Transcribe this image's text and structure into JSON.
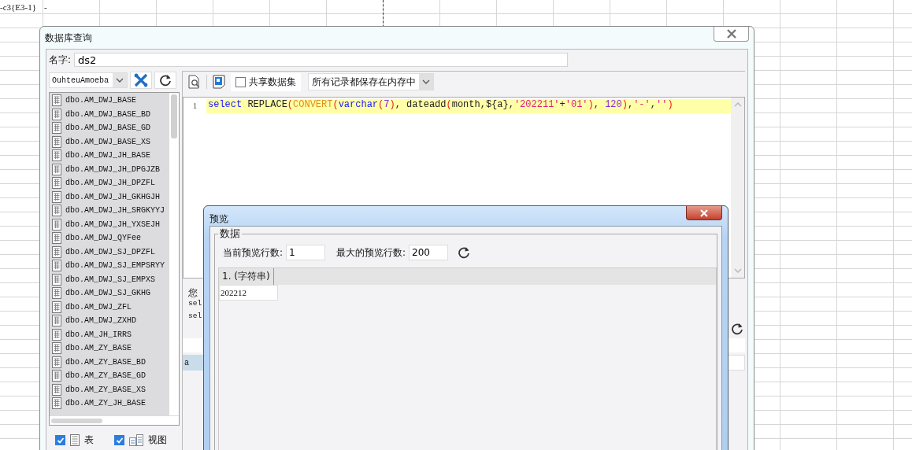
{
  "spreadsheet": {
    "cells": [
      "-c3{E3-1}",
      "-"
    ]
  },
  "dialog": {
    "title": "数据库查询",
    "name_label": "名字:",
    "name_value": "ds2",
    "connection": "OuhteuAmoeba",
    "tables": [
      "dbo.AM_DWJ_BASE",
      "dbo.AM_DWJ_BASE_BD",
      "dbo.AM_DWJ_BASE_GD",
      "dbo.AM_DWJ_BASE_XS",
      "dbo.AM_DWJ_JH_BASE",
      "dbo.AM_DWJ_JH_DPGJZB",
      "dbo.AM_DWJ_JH_DPZFL",
      "dbo.AM_DWJ_JH_GKHGJH",
      "dbo.AM_DWJ_JH_SRGKYYJ",
      "dbo.AM_DWJ_JH_YXSEJH",
      "dbo.AM_DWJ_QYFee",
      "dbo.AM_DWJ_SJ_DPZFL",
      "dbo.AM_DWJ_SJ_EMPSRYY",
      "dbo.AM_DWJ_SJ_EMPXS",
      "dbo.AM_DWJ_SJ_GKHG",
      "dbo.AM_DWJ_ZFL",
      "dbo.AM_DWJ_ZXHD",
      "dbo.AM_JH_IRRS",
      "dbo.AM_ZY_BASE",
      "dbo.AM_ZY_BASE_BD",
      "dbo.AM_ZY_BASE_GD",
      "dbo.AM_ZY_BASE_XS",
      "dbo.AM_ZY_JH_BASE"
    ],
    "filters": [
      {
        "label": "表",
        "kind": "table",
        "checked": true
      },
      {
        "label": "视图",
        "kind": "view",
        "checked": true
      }
    ],
    "share_checkbox": {
      "label": "共享数据集",
      "checked": false
    },
    "storage_mode": "所有记录都保存在内存中",
    "editor": {
      "line_number": "1",
      "tokens": [
        {
          "text": "select",
          "kind": "keyword"
        },
        {
          "text": " REPLACE",
          "kind": "plain"
        },
        {
          "text": "(",
          "kind": "paren"
        },
        {
          "text": "CONVERT",
          "kind": "function"
        },
        {
          "text": "(",
          "kind": "paren"
        },
        {
          "text": "varchar",
          "kind": "keyword"
        },
        {
          "text": "(",
          "kind": "paren"
        },
        {
          "text": "7",
          "kind": "number"
        },
        {
          "text": ")",
          "kind": "paren"
        },
        {
          "text": ", dateadd",
          "kind": "plain"
        },
        {
          "text": "(",
          "kind": "paren"
        },
        {
          "text": "month,${a},",
          "kind": "plain"
        },
        {
          "text": "'202211'",
          "kind": "string"
        },
        {
          "text": "+",
          "kind": "plain"
        },
        {
          "text": "'01'",
          "kind": "string"
        },
        {
          "text": ")",
          "kind": "paren"
        },
        {
          "text": ", ",
          "kind": "plain"
        },
        {
          "text": "120",
          "kind": "number"
        },
        {
          "text": ")",
          "kind": "paren"
        },
        {
          "text": ",",
          "kind": "plain"
        },
        {
          "text": "'-'",
          "kind": "string"
        },
        {
          "text": ",",
          "kind": "plain"
        },
        {
          "text": "''",
          "kind": "string"
        },
        {
          "text": ")",
          "kind": "paren"
        }
      ]
    },
    "hint_lines": [
      {
        "text": "您",
        "kind": "prose"
      },
      {
        "text": "sel",
        "kind": "code"
      },
      {
        "text": "sel",
        "kind": "code"
      }
    ],
    "params_table": {
      "rows": [
        {
          "name": "a",
          "selected": true
        }
      ]
    }
  },
  "preview": {
    "title": "预览",
    "group_label": "数据",
    "current_rows_label": "当前预览行数:",
    "current_rows": "1",
    "max_rows_label": "最大的预览行数:",
    "max_rows": "200",
    "columns": [
      "1. (字符串)"
    ],
    "rows": [
      [
        "202212"
      ]
    ]
  }
}
